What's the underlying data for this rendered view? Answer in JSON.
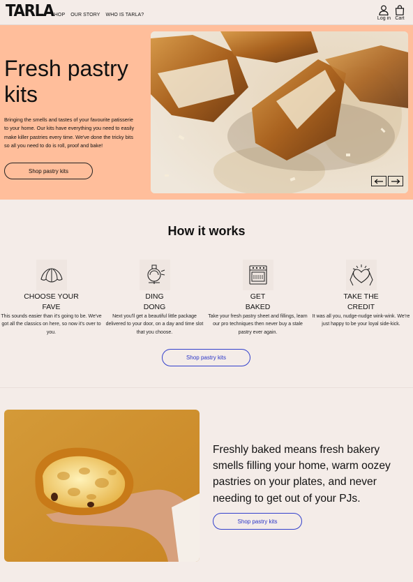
{
  "header": {
    "logo": "TARLA",
    "nav": [
      {
        "label": "SHOP"
      },
      {
        "label": "OUR STORY"
      },
      {
        "label": "WHO IS TARLA?"
      }
    ],
    "login_label": "Log in",
    "cart_label": "Cart"
  },
  "hero": {
    "title": "Fresh pastry kits",
    "text": "Bringing the smells and tastes of your favourite patisserie to your home. Our kits have everything you need to easily make killer pastries every time. We've done the tricky bits so all you need to do is roll, proof and bake!",
    "button_label": "Shop pastry kits"
  },
  "how": {
    "title": "How it works",
    "steps": [
      {
        "title": "CHOOSE YOUR\nFAVE",
        "text": "This sounds easier than it's going to be. We've got all the classics on here, so now it's over to you.",
        "icon": "croissant-icon"
      },
      {
        "title": "DING\nDONG",
        "text": "Next you'll get a beautiful little package delivered to your door, on a day and time slot that you choose.",
        "icon": "bell-icon"
      },
      {
        "title": "GET\nBAKED",
        "text": "Take your fresh pastry sheet and fillings, learn our pro techniques then never buy a stale pastry ever again.",
        "icon": "oven-icon"
      },
      {
        "title": "TAKE THE\nCREDIT",
        "text": "It was all you, nudge-nudge wink-wink. We're just happy to be your loyal side-kick.",
        "icon": "heart-hands-icon"
      }
    ],
    "button_label": "Shop pastry kits"
  },
  "bottom": {
    "text": "Freshly baked means fresh bakery smells filling your home, warm oozey pastries on your plates, and never needing to get out of your PJs.",
    "button_label": "Shop pastry kits"
  },
  "colors": {
    "hero_bg": "#ffbe9b",
    "page_bg": "#f4ece8",
    "accent_blue": "#2a35c7"
  }
}
